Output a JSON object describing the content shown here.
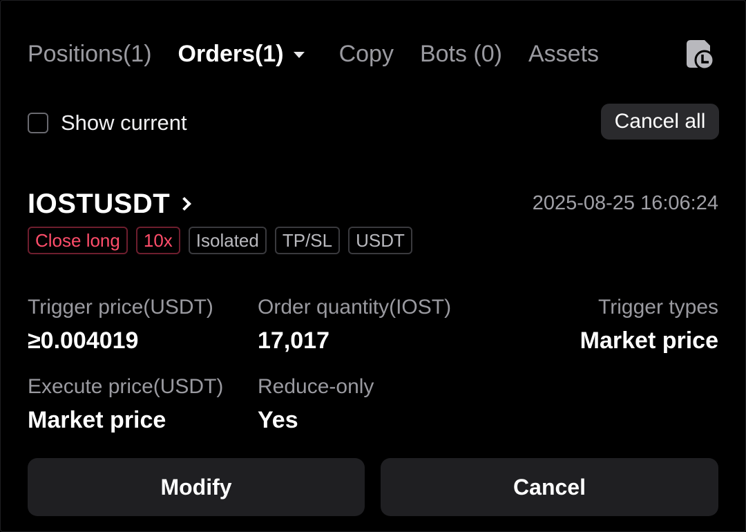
{
  "tabs": [
    {
      "label": "Positions(1)",
      "active": false
    },
    {
      "label": "Orders(1)",
      "active": true
    },
    {
      "label": "Copy",
      "active": false
    },
    {
      "label": "Bots (0)",
      "active": false
    },
    {
      "label": "Assets",
      "active": false
    }
  ],
  "filter": {
    "show_current_label": "Show current",
    "show_current_checked": false,
    "cancel_all_label": "Cancel all"
  },
  "order": {
    "symbol": "IOSTUSDT",
    "timestamp": "2025-08-25 16:06:24",
    "tags": [
      {
        "label": "Close long",
        "style": "red"
      },
      {
        "label": "10x",
        "style": "red"
      },
      {
        "label": "Isolated",
        "style": "neutral"
      },
      {
        "label": "TP/SL",
        "style": "neutral"
      },
      {
        "label": "USDT",
        "style": "neutral"
      }
    ],
    "trigger_price_label": "Trigger price(USDT)",
    "trigger_price_value": "≥0.004019",
    "order_quantity_label": "Order quantity(IOST)",
    "order_quantity_value": "17,017",
    "trigger_types_label": "Trigger types",
    "trigger_types_value": "Market price",
    "execute_price_label": "Execute price(USDT)",
    "execute_price_value": "Market price",
    "reduce_only_label": "Reduce-only",
    "reduce_only_value": "Yes",
    "modify_label": "Modify",
    "cancel_label": "Cancel"
  },
  "colors": {
    "background": "#000000",
    "accent_red": "#ff4d6a",
    "button_bg": "#1f1f22",
    "muted_text": "#9a9aa0"
  },
  "icons": {
    "history": "order-history-icon",
    "dropdown": "caret-down-icon",
    "symbol_link": "chevron-right-icon"
  }
}
